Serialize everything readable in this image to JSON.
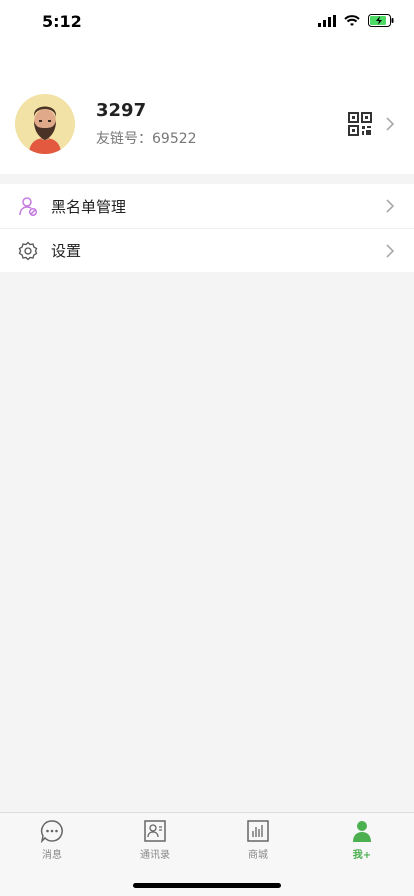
{
  "status_bar": {
    "time": "5:12"
  },
  "profile": {
    "name": "3297",
    "id_text": "友链号：69522"
  },
  "menu": {
    "items": [
      {
        "label": "黑名单管理",
        "icon": "user-block-icon"
      },
      {
        "label": "设置",
        "icon": "gear-icon"
      }
    ]
  },
  "tabbar": {
    "tabs": [
      {
        "label": "消息",
        "icon": "chat-icon",
        "active": false
      },
      {
        "label": "通讯录",
        "icon": "contacts-icon",
        "active": false
      },
      {
        "label": "商城",
        "icon": "shop-chart-icon",
        "active": false
      },
      {
        "label": "我+",
        "icon": "person-icon",
        "active": true
      }
    ]
  },
  "colors": {
    "accent": "#4caf50",
    "menu_icon_purple": "#c57be0"
  }
}
